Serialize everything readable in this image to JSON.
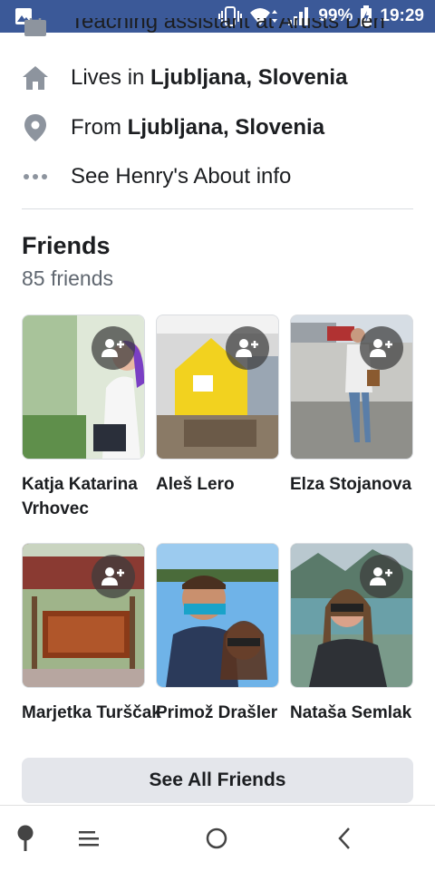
{
  "status_bar": {
    "battery_percent": "99%",
    "time": "19:29",
    "icons": [
      "image-icon",
      "vibrate-icon",
      "wifi-icon",
      "signal-icon",
      "battery-charging-icon"
    ]
  },
  "about": {
    "partial_row": "Teaching assistant at Artists Den",
    "lives_prefix": "Lives in ",
    "lives_place": "Ljubljana, Slovenia",
    "from_prefix": "From ",
    "from_place": "Ljubljana, Slovenia",
    "see_about": "See Henry's About info"
  },
  "friends": {
    "title": "Friends",
    "count_text": "85 friends",
    "items": [
      {
        "name": "Katja Katarina Vrhovec"
      },
      {
        "name": "Aleš Lero"
      },
      {
        "name": "Elza Stojanova"
      },
      {
        "name": "Marjetka Turščak"
      },
      {
        "name": "Primož Drašler"
      },
      {
        "name": "Nataša Semlak"
      }
    ],
    "see_all_label": "See All Friends"
  },
  "colors": {
    "brand": "#3b5998",
    "button_bg": "#e4e6eb",
    "secondary_text": "#606770"
  }
}
